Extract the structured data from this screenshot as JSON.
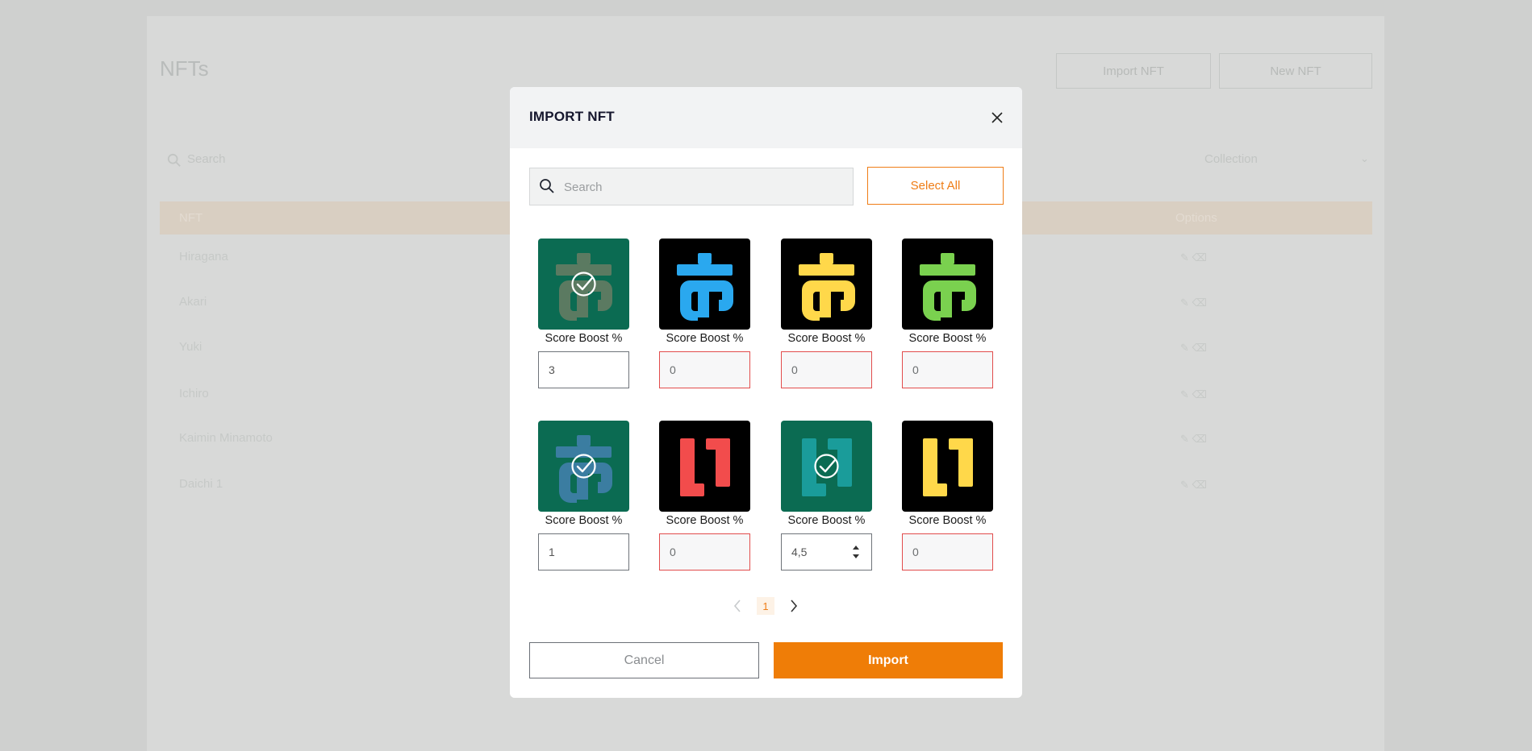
{
  "background": {
    "title": "NFTs",
    "import_button": "Import NFT",
    "new_button": "New NFT",
    "search_placeholder": "Search",
    "filter_label": "Collection",
    "table": {
      "col_nft": "NFT",
      "col_options": "Options",
      "rows": [
        "Hiragana",
        "Akari",
        "Yuki",
        "Ichiro",
        "Kaimin Minamoto",
        "Daichi 1"
      ]
    }
  },
  "modal": {
    "title": "IMPORT NFT",
    "search_placeholder": "Search",
    "select_all_label": "Select All",
    "score_label": "Score Boost %",
    "nfts": [
      {
        "glyph": "a",
        "fg": "#5b7a61",
        "bg": "#0b6b52",
        "selected": true,
        "value": "3",
        "valid": true
      },
      {
        "glyph": "a",
        "fg": "#2aa8ef",
        "bg": "#000000",
        "selected": false,
        "value": "0",
        "valid": false
      },
      {
        "glyph": "a",
        "fg": "#ffd84a",
        "bg": "#000000",
        "selected": false,
        "value": "0",
        "valid": false
      },
      {
        "glyph": "a",
        "fg": "#7ad14f",
        "bg": "#000000",
        "selected": false,
        "value": "0",
        "valid": false
      },
      {
        "glyph": "a",
        "fg": "#3b7da1",
        "bg": "#0b6b52",
        "selected": true,
        "value": "1",
        "valid": true
      },
      {
        "glyph": "i",
        "fg": "#f24c4c",
        "bg": "#000000",
        "selected": false,
        "value": "0",
        "valid": false
      },
      {
        "glyph": "i",
        "fg": "#1a9c9a",
        "bg": "#0b6b52",
        "selected": true,
        "value": "4,5",
        "valid": true
      },
      {
        "glyph": "i",
        "fg": "#ffd84a",
        "bg": "#000000",
        "selected": false,
        "value": "0",
        "valid": false
      }
    ],
    "pagination": {
      "current_page": "1"
    },
    "cancel_label": "Cancel",
    "import_label": "Import"
  },
  "colors": {
    "accent": "#ef7d07",
    "error_border": "#e24c4c"
  }
}
